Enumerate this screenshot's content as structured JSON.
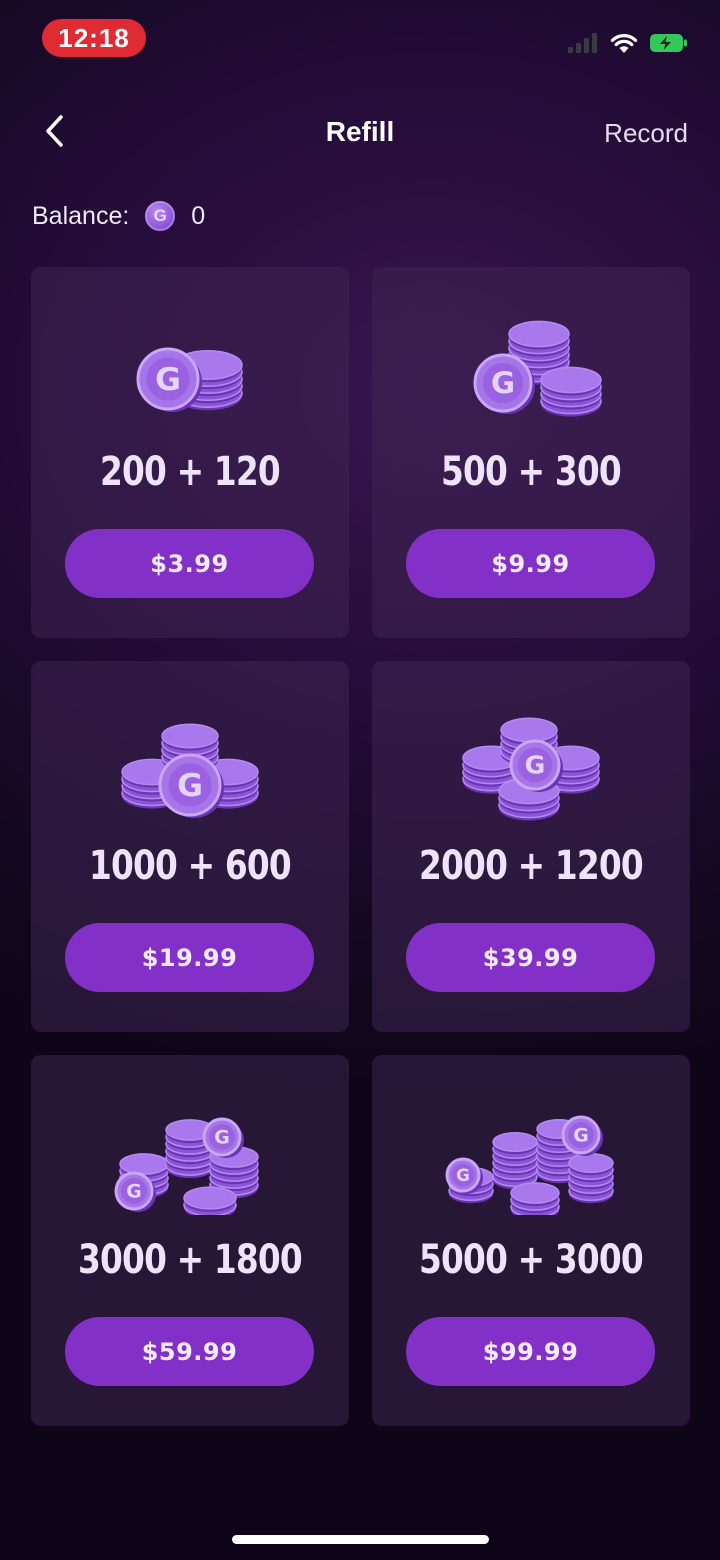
{
  "status_bar": {
    "time": "12:18",
    "icons": [
      "cellular-signal-icon",
      "wifi-icon",
      "battery-charging-icon"
    ]
  },
  "header": {
    "title": "Refill",
    "back_icon": "chevron-left-icon",
    "record_label": "Record"
  },
  "balance": {
    "label": "Balance:",
    "coin_letter": "G",
    "value": "0"
  },
  "packages": [
    {
      "amount": "200 + 120",
      "price": "$3.99",
      "art": "coin-stack-small"
    },
    {
      "amount": "500 + 300",
      "price": "$9.99",
      "art": "coin-stack-medium"
    },
    {
      "amount": "1000 + 600",
      "price": "$19.99",
      "art": "coin-stack-large"
    },
    {
      "amount": "2000 + 1200",
      "price": "$39.99",
      "art": "coin-pile-medium"
    },
    {
      "amount": "3000 + 1800",
      "price": "$59.99",
      "art": "coin-pile-large"
    },
    {
      "amount": "5000 + 3000",
      "price": "$99.99",
      "art": "coin-pile-huge"
    }
  ],
  "colors": {
    "accent": "#8330c9",
    "status_time_bg": "#e02a34",
    "battery": "#34c759",
    "coin": "#9a62e0"
  }
}
